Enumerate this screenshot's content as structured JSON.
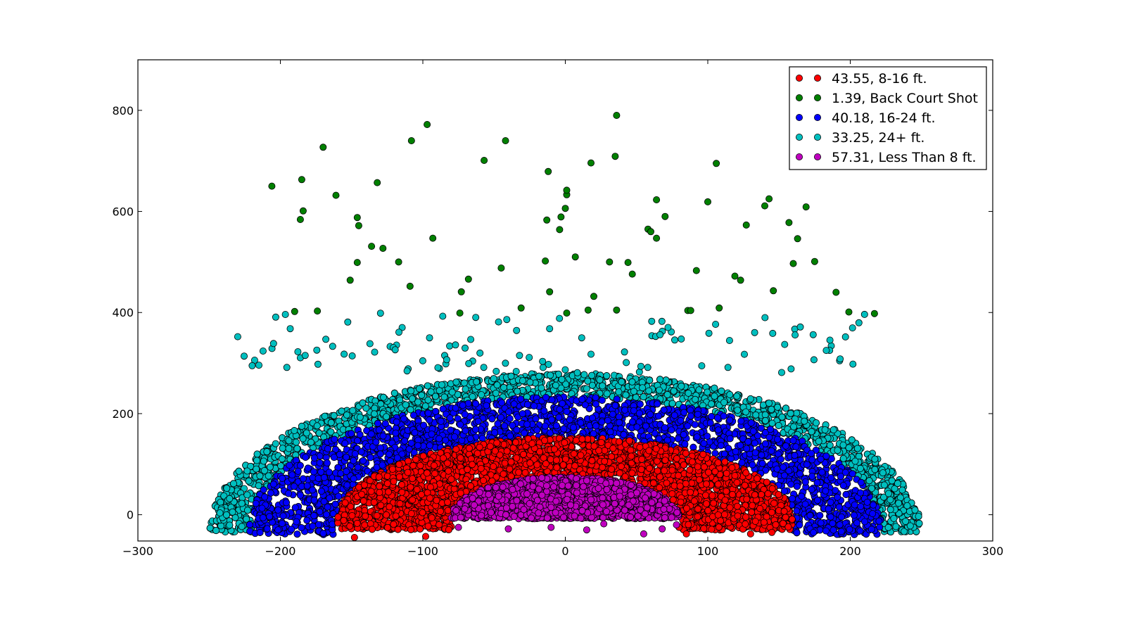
{
  "chart_data": {
    "type": "scatter",
    "title": "",
    "xlabel": "",
    "ylabel": "",
    "xlim": [
      -300,
      300
    ],
    "ylim": [
      -52,
      900
    ],
    "x_ticks": [
      -300,
      -200,
      -100,
      0,
      100,
      200,
      300
    ],
    "y_ticks": [
      0,
      200,
      400,
      600,
      800
    ],
    "x_tick_labels": [
      "−300",
      "−200",
      "−100",
      "0",
      "100",
      "200",
      "300"
    ],
    "y_tick_labels": [
      "0",
      "200",
      "400",
      "600",
      "800"
    ],
    "grid": false,
    "legend_position": "top-right",
    "series": [
      {
        "name": "43.55, 8-16 ft.",
        "color": "#ff0000",
        "zone": "8-16",
        "inner_radius_ft": 8,
        "outer_radius_ft": 16,
        "approx_count": 4200
      },
      {
        "name": "1.39, Back Court Shot",
        "color": "#008000",
        "zone": "backcourt",
        "points": [
          [
            -206,
            650
          ],
          [
            -185,
            663
          ],
          [
            -170,
            727
          ],
          [
            -161,
            632
          ],
          [
            -184,
            601
          ],
          [
            -186,
            584
          ],
          [
            -146,
            588
          ],
          [
            -145,
            572
          ],
          [
            -132,
            657
          ],
          [
            -136,
            531
          ],
          [
            -128,
            527
          ],
          [
            -117,
            500
          ],
          [
            -146,
            499
          ],
          [
            -151,
            464
          ],
          [
            -108,
            740
          ],
          [
            -97,
            772
          ],
          [
            -93,
            547
          ],
          [
            -109,
            452
          ],
          [
            -73,
            441
          ],
          [
            -68,
            466
          ],
          [
            -74,
            399
          ],
          [
            -57,
            701
          ],
          [
            -42,
            740
          ],
          [
            -45,
            488
          ],
          [
            -31,
            409
          ],
          [
            -12,
            679
          ],
          [
            -13,
            583
          ],
          [
            -14,
            502
          ],
          [
            -11,
            441
          ],
          [
            -4,
            564
          ],
          [
            -3,
            589
          ],
          [
            0,
            606
          ],
          [
            1,
            633
          ],
          [
            1,
            642
          ],
          [
            1,
            399
          ],
          [
            7,
            510
          ],
          [
            16,
            405
          ],
          [
            18,
            696
          ],
          [
            20,
            432
          ],
          [
            31,
            500
          ],
          [
            35,
            709
          ],
          [
            36,
            790
          ],
          [
            36,
            405
          ],
          [
            44,
            499
          ],
          [
            47,
            476
          ],
          [
            58,
            565
          ],
          [
            60,
            560
          ],
          [
            64,
            547
          ],
          [
            64,
            623
          ],
          [
            70,
            590
          ],
          [
            86,
            404
          ],
          [
            88,
            404
          ],
          [
            92,
            483
          ],
          [
            100,
            619
          ],
          [
            106,
            695
          ],
          [
            108,
            409
          ],
          [
            119,
            472
          ],
          [
            123,
            464
          ],
          [
            127,
            573
          ],
          [
            140,
            611
          ],
          [
            143,
            625
          ],
          [
            146,
            443
          ],
          [
            157,
            578
          ],
          [
            160,
            497
          ],
          [
            163,
            546
          ],
          [
            169,
            609
          ],
          [
            175,
            501
          ],
          [
            190,
            440
          ],
          [
            199,
            401
          ],
          [
            217,
            398
          ],
          [
            -190,
            402
          ],
          [
            -174,
            403
          ]
        ]
      },
      {
        "name": "40.18, 16-24 ft.",
        "color": "#0000ff",
        "zone": "16-24",
        "inner_radius_ft": 16,
        "outer_radius_ft": 24,
        "approx_count": 4000
      },
      {
        "name": "33.25, 24+ ft.",
        "color": "#00bfbf",
        "zone": "24+",
        "inner_radius_ft": 24,
        "outer_radius_ft": 26,
        "approx_count": 3400
      },
      {
        "name": "57.31, Less Than 8 ft.",
        "color": "#bf00bf",
        "zone": "0-8",
        "inner_radius_ft": 0,
        "outer_radius_ft": 8,
        "approx_count": 2200
      }
    ]
  }
}
